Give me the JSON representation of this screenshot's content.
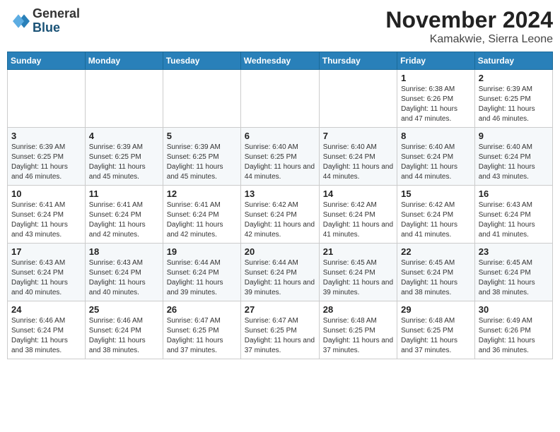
{
  "header": {
    "logo_line1": "General",
    "logo_line2": "Blue",
    "month": "November 2024",
    "location": "Kamakwie, Sierra Leone"
  },
  "weekdays": [
    "Sunday",
    "Monday",
    "Tuesday",
    "Wednesday",
    "Thursday",
    "Friday",
    "Saturday"
  ],
  "weeks": [
    [
      {
        "day": "",
        "info": ""
      },
      {
        "day": "",
        "info": ""
      },
      {
        "day": "",
        "info": ""
      },
      {
        "day": "",
        "info": ""
      },
      {
        "day": "",
        "info": ""
      },
      {
        "day": "1",
        "info": "Sunrise: 6:38 AM\nSunset: 6:26 PM\nDaylight: 11 hours and 47 minutes."
      },
      {
        "day": "2",
        "info": "Sunrise: 6:39 AM\nSunset: 6:25 PM\nDaylight: 11 hours and 46 minutes."
      }
    ],
    [
      {
        "day": "3",
        "info": "Sunrise: 6:39 AM\nSunset: 6:25 PM\nDaylight: 11 hours and 46 minutes."
      },
      {
        "day": "4",
        "info": "Sunrise: 6:39 AM\nSunset: 6:25 PM\nDaylight: 11 hours and 45 minutes."
      },
      {
        "day": "5",
        "info": "Sunrise: 6:39 AM\nSunset: 6:25 PM\nDaylight: 11 hours and 45 minutes."
      },
      {
        "day": "6",
        "info": "Sunrise: 6:40 AM\nSunset: 6:25 PM\nDaylight: 11 hours and 44 minutes."
      },
      {
        "day": "7",
        "info": "Sunrise: 6:40 AM\nSunset: 6:24 PM\nDaylight: 11 hours and 44 minutes."
      },
      {
        "day": "8",
        "info": "Sunrise: 6:40 AM\nSunset: 6:24 PM\nDaylight: 11 hours and 44 minutes."
      },
      {
        "day": "9",
        "info": "Sunrise: 6:40 AM\nSunset: 6:24 PM\nDaylight: 11 hours and 43 minutes."
      }
    ],
    [
      {
        "day": "10",
        "info": "Sunrise: 6:41 AM\nSunset: 6:24 PM\nDaylight: 11 hours and 43 minutes."
      },
      {
        "day": "11",
        "info": "Sunrise: 6:41 AM\nSunset: 6:24 PM\nDaylight: 11 hours and 42 minutes."
      },
      {
        "day": "12",
        "info": "Sunrise: 6:41 AM\nSunset: 6:24 PM\nDaylight: 11 hours and 42 minutes."
      },
      {
        "day": "13",
        "info": "Sunrise: 6:42 AM\nSunset: 6:24 PM\nDaylight: 11 hours and 42 minutes."
      },
      {
        "day": "14",
        "info": "Sunrise: 6:42 AM\nSunset: 6:24 PM\nDaylight: 11 hours and 41 minutes."
      },
      {
        "day": "15",
        "info": "Sunrise: 6:42 AM\nSunset: 6:24 PM\nDaylight: 11 hours and 41 minutes."
      },
      {
        "day": "16",
        "info": "Sunrise: 6:43 AM\nSunset: 6:24 PM\nDaylight: 11 hours and 41 minutes."
      }
    ],
    [
      {
        "day": "17",
        "info": "Sunrise: 6:43 AM\nSunset: 6:24 PM\nDaylight: 11 hours and 40 minutes."
      },
      {
        "day": "18",
        "info": "Sunrise: 6:43 AM\nSunset: 6:24 PM\nDaylight: 11 hours and 40 minutes."
      },
      {
        "day": "19",
        "info": "Sunrise: 6:44 AM\nSunset: 6:24 PM\nDaylight: 11 hours and 39 minutes."
      },
      {
        "day": "20",
        "info": "Sunrise: 6:44 AM\nSunset: 6:24 PM\nDaylight: 11 hours and 39 minutes."
      },
      {
        "day": "21",
        "info": "Sunrise: 6:45 AM\nSunset: 6:24 PM\nDaylight: 11 hours and 39 minutes."
      },
      {
        "day": "22",
        "info": "Sunrise: 6:45 AM\nSunset: 6:24 PM\nDaylight: 11 hours and 38 minutes."
      },
      {
        "day": "23",
        "info": "Sunrise: 6:45 AM\nSunset: 6:24 PM\nDaylight: 11 hours and 38 minutes."
      }
    ],
    [
      {
        "day": "24",
        "info": "Sunrise: 6:46 AM\nSunset: 6:24 PM\nDaylight: 11 hours and 38 minutes."
      },
      {
        "day": "25",
        "info": "Sunrise: 6:46 AM\nSunset: 6:24 PM\nDaylight: 11 hours and 38 minutes."
      },
      {
        "day": "26",
        "info": "Sunrise: 6:47 AM\nSunset: 6:25 PM\nDaylight: 11 hours and 37 minutes."
      },
      {
        "day": "27",
        "info": "Sunrise: 6:47 AM\nSunset: 6:25 PM\nDaylight: 11 hours and 37 minutes."
      },
      {
        "day": "28",
        "info": "Sunrise: 6:48 AM\nSunset: 6:25 PM\nDaylight: 11 hours and 37 minutes."
      },
      {
        "day": "29",
        "info": "Sunrise: 6:48 AM\nSunset: 6:25 PM\nDaylight: 11 hours and 37 minutes."
      },
      {
        "day": "30",
        "info": "Sunrise: 6:49 AM\nSunset: 6:26 PM\nDaylight: 11 hours and 36 minutes."
      }
    ]
  ]
}
